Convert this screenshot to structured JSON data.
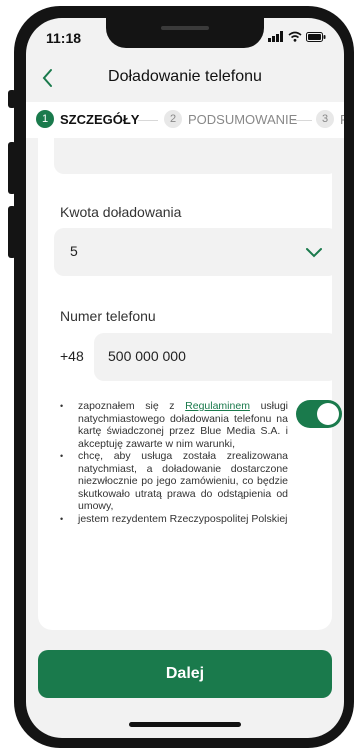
{
  "status_bar": {
    "time": "11:18"
  },
  "header": {
    "title": "Doładowanie telefonu",
    "back_icon": "chevron-left-icon"
  },
  "steps": [
    {
      "number": "1",
      "label": "SZCZEGÓŁY",
      "active": true
    },
    {
      "number": "2",
      "label": "PODSUMOWANIE",
      "active": false
    },
    {
      "number": "3",
      "label": "PO",
      "active": false
    }
  ],
  "form": {
    "amount": {
      "label": "Kwota doładowania",
      "value": "5"
    },
    "phone": {
      "label": "Numer telefonu",
      "prefix": "+48",
      "value": "500 000 000"
    }
  },
  "terms": {
    "item1_prefix": "zapoznałem się z",
    "item1_link": "Regulaminem",
    "item1_suffix": "usługi natychmiastowego doładowania telefonu na kartę świadczonej przez Blue Media S.A. i akceptuję zawarte w nim warunki,",
    "item2": "chcę, aby usługa została zrealizowana natychmiast, a doładowanie dostarczone niezwłocznie po jego zamówieniu, co będzie skutkowało utratą prawa do odstąpienia od umowy,",
    "item3": "jestem rezydentem Rzeczypospolitej Polskiej",
    "toggle_on": true
  },
  "footer": {
    "cta_label": "Dalej"
  },
  "colors": {
    "accent": "#1a7a4c"
  }
}
